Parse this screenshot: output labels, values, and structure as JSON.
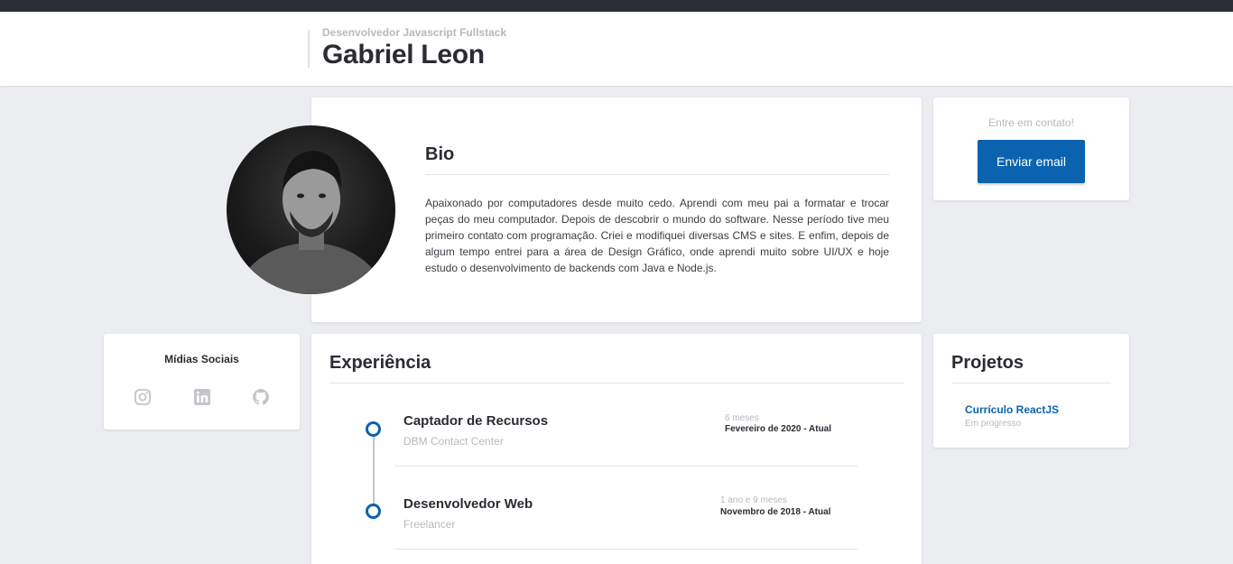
{
  "header": {
    "subtitle": "Desenvolvedor Javascript Fullstack",
    "title": "Gabriel Leon"
  },
  "bio": {
    "title": "Bio",
    "text": "Apaixonado por computadores desde muito cedo. Aprendi com meu pai a formatar e trocar peças do meu computador. Depois de descobrir o mundo do software. Nesse período tive meu primeiro contato com programação. Criei e modifiquei diversas CMS e sites. E enfim, depois de algum tempo entrei para a área de Design Gráfico, onde aprendi muito sobre UI/UX e hoje estudo o desenvolvimento de backends com Java e Node.js."
  },
  "contact": {
    "label": "Entre em contato!",
    "button_label": "Enviar email"
  },
  "social": {
    "title": "Mídias Sociais",
    "icons": [
      "instagram-icon",
      "linkedin-icon",
      "github-icon"
    ]
  },
  "experience": {
    "title": "Experiência",
    "jobs": [
      {
        "title": "Captador de Recursos",
        "company": "DBM Contact Center",
        "duration": "6 meses",
        "period": "Fevereiro de 2020 - Atual"
      },
      {
        "title": "Desenvolvedor Web",
        "company": "Freelancer",
        "duration": "1 ano e 9 meses",
        "period": "Novembro de 2018 - Atual"
      }
    ]
  },
  "projects": {
    "title": "Projetos",
    "items": [
      {
        "name": "Currículo ReactJS",
        "status": "Em progresso"
      }
    ]
  },
  "colors": {
    "accent": "#0b63b0",
    "background": "#ecedf1",
    "topbar": "#2d2d35",
    "muted_text": "#b8b9bf"
  }
}
